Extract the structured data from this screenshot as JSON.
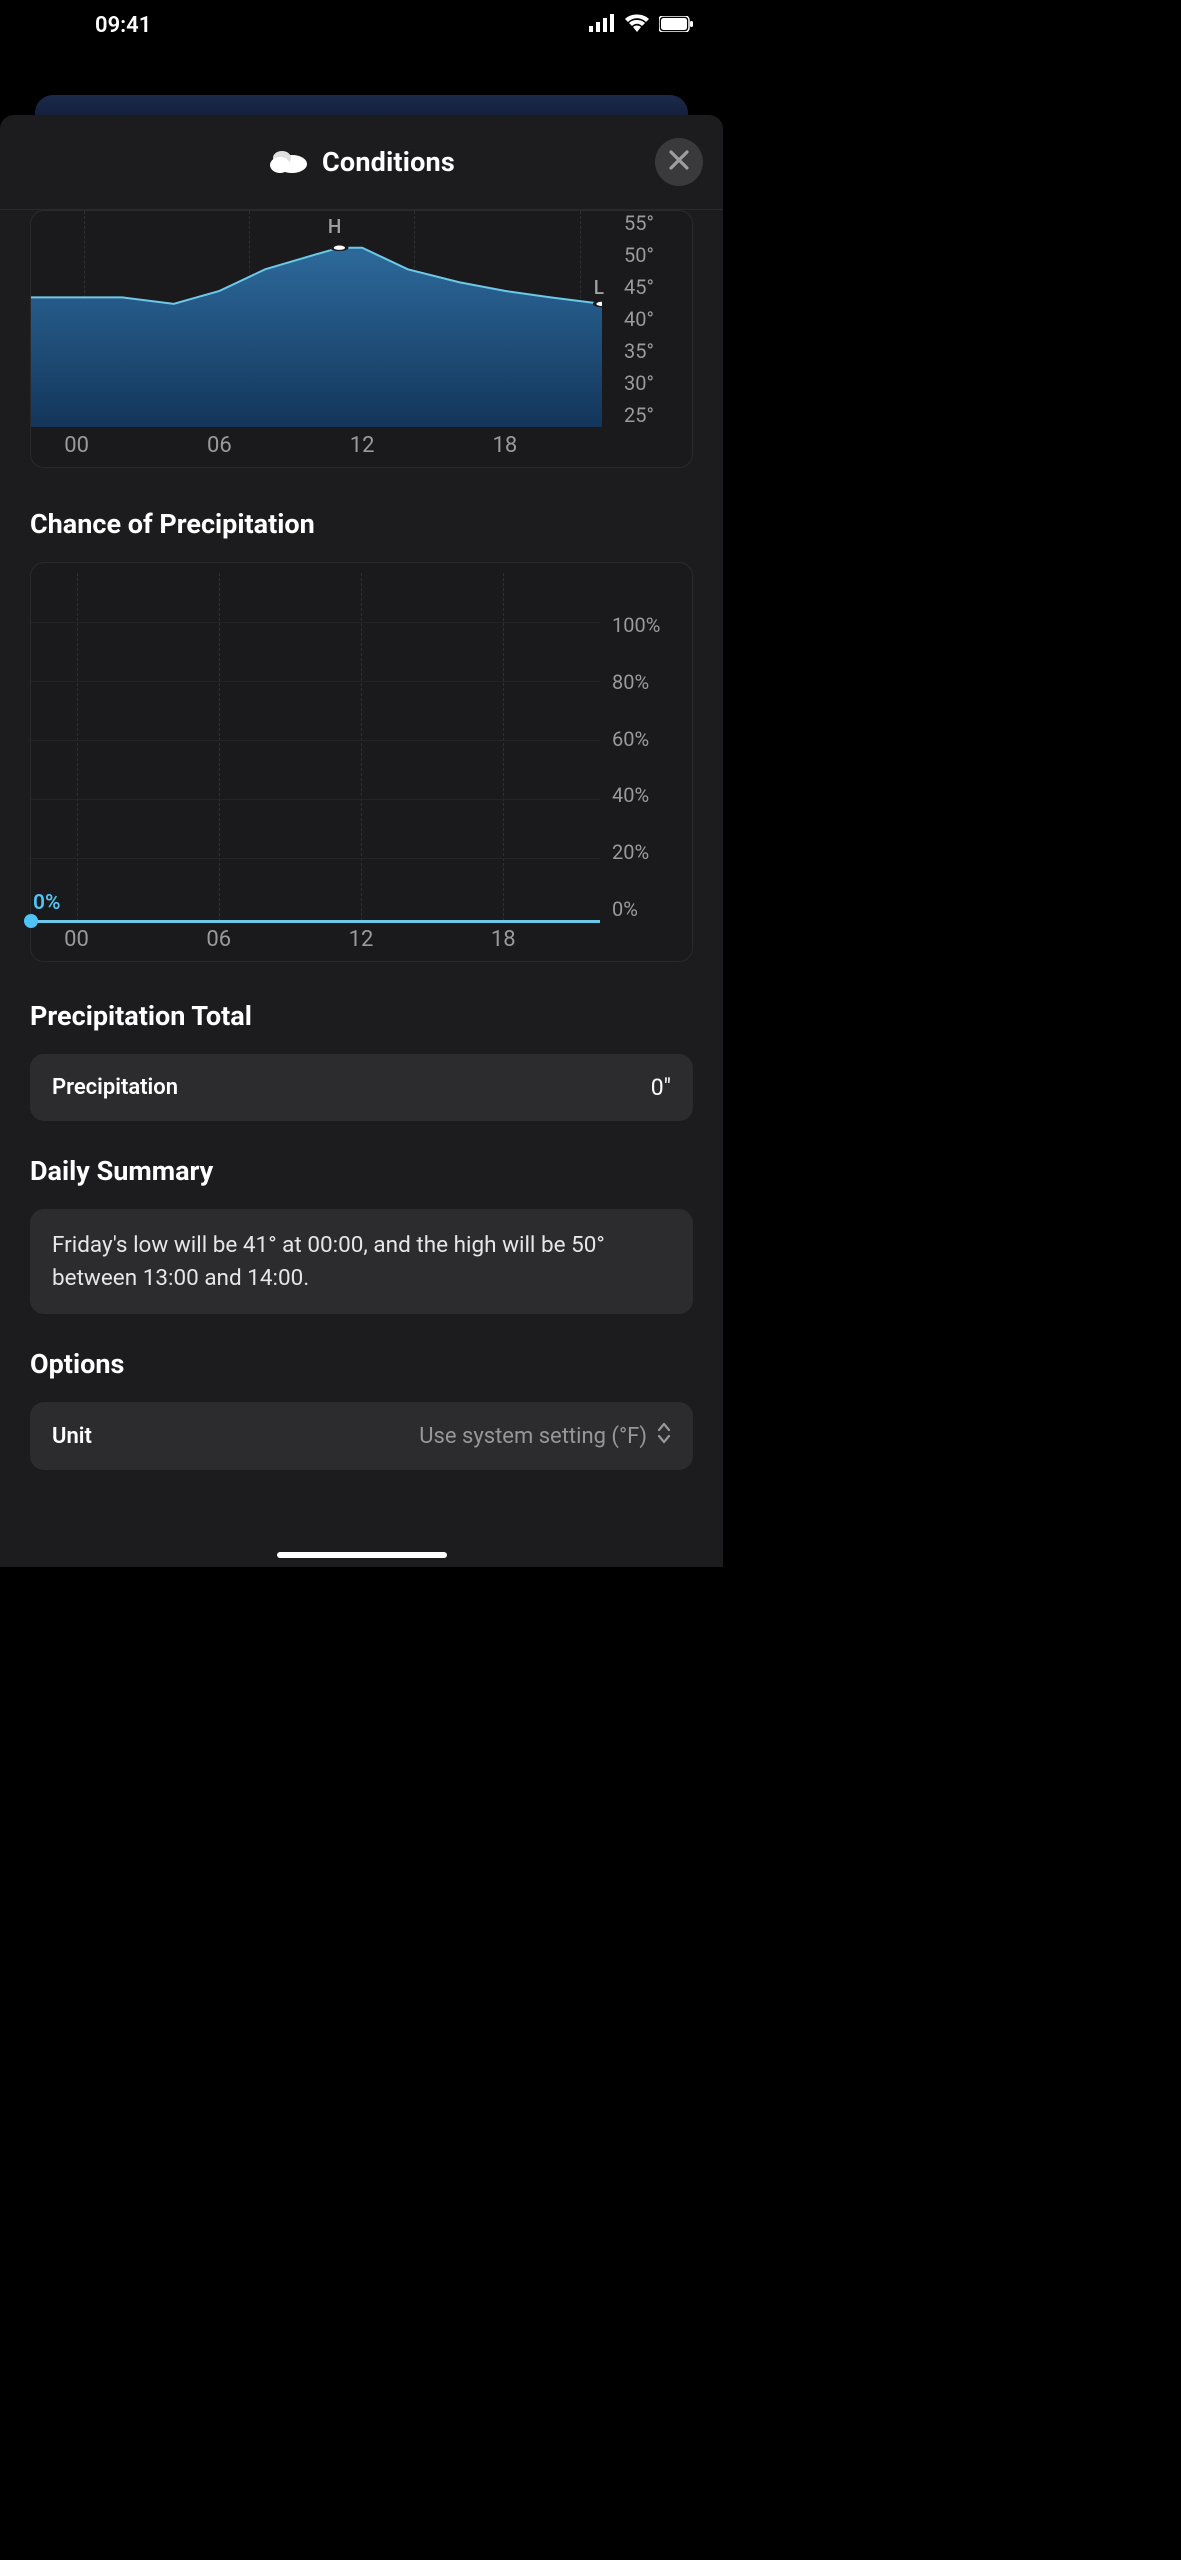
{
  "status_bar": {
    "time": "09:41"
  },
  "sheet": {
    "title": "Conditions"
  },
  "chart_data": [
    {
      "type": "area",
      "name": "temperature",
      "x_ticks": [
        "00",
        "06",
        "12",
        "18"
      ],
      "y_ticks": [
        "55°",
        "50°",
        "45°",
        "40°",
        "35°",
        "30°",
        "25°"
      ],
      "ylim": [
        25,
        55
      ],
      "xlim": [
        0,
        24
      ],
      "high_label": "H",
      "low_label": "L",
      "series": [
        {
          "name": "temp",
          "x": [
            0,
            2,
            4,
            6,
            8,
            10,
            12,
            13,
            14,
            16,
            18,
            20,
            22,
            24
          ],
          "values": [
            43,
            43,
            43,
            42,
            44,
            47,
            49,
            50,
            50,
            47,
            45,
            44,
            43,
            42
          ]
        }
      ],
      "high": {
        "hour": 13,
        "value": 50
      },
      "low": {
        "hour": 24,
        "value": 42
      }
    },
    {
      "type": "line",
      "name": "chance_of_precipitation",
      "title": "Chance of Precipitation",
      "x_ticks": [
        "00",
        "06",
        "12",
        "18"
      ],
      "y_ticks": [
        "100%",
        "80%",
        "60%",
        "40%",
        "20%",
        "0%"
      ],
      "ylim": [
        0,
        100
      ],
      "xlim": [
        0,
        24
      ],
      "point_label": "0%",
      "series": [
        {
          "name": "precip_chance",
          "x": [
            0,
            6,
            12,
            18,
            24
          ],
          "values": [
            0,
            0,
            0,
            0,
            0
          ]
        }
      ]
    }
  ],
  "sections": {
    "precip_total": {
      "title": "Precipitation Total",
      "row_label": "Precipitation",
      "row_value": "0\""
    },
    "daily_summary": {
      "title": "Daily Summary",
      "text": "Friday's low will be 41° at 00:00, and the high will be 50° between 13:00 and 14:00."
    },
    "options": {
      "title": "Options",
      "row_label": "Unit",
      "row_value": "Use system setting (°F)"
    }
  }
}
